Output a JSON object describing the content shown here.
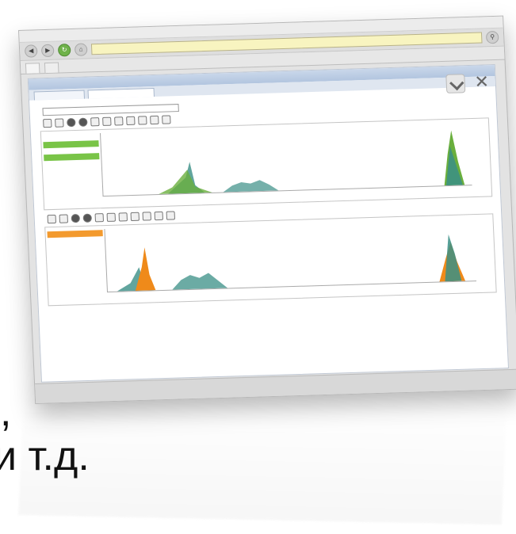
{
  "caption": {
    "comma": ",",
    "text": "и т.д."
  },
  "colors": {
    "green_series": "#6aaf3d",
    "orange_series": "#ef8a1a",
    "teal_series": "#3a8f86",
    "highlight_green": "#79c447",
    "highlight_orange": "#f39a2e"
  },
  "panels": [
    {
      "ymax": "4000",
      "series": [
        "green",
        "teal"
      ]
    },
    {
      "ymax": "4000",
      "series": [
        "orange",
        "teal"
      ]
    }
  ]
}
